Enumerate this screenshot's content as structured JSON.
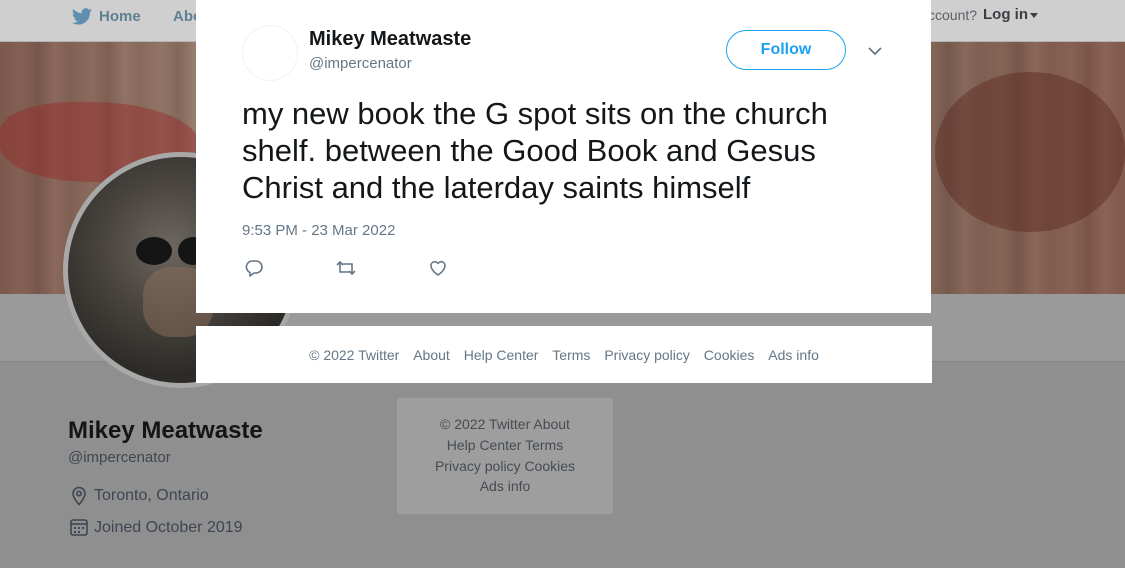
{
  "topbar": {
    "home_label": "Home",
    "about_label": "Abo",
    "account_text": "ccount?",
    "login_label": "Log in",
    "icons": [
      "twitter-bird-icon",
      "caret-down-icon"
    ]
  },
  "profile": {
    "name": "Mikey Meatwaste",
    "handle": "@impercenator",
    "location": "Toronto, Ontario",
    "joined": "Joined October 2019",
    "icons": [
      "location-pin-icon",
      "calendar-icon"
    ]
  },
  "dim_footer": {
    "line1": "© 2022 Twitter   About",
    "line2": "Help Center   Terms",
    "line3": "Privacy policy   Cookies",
    "line4": "Ads info"
  },
  "tweet": {
    "author_name": "Mikey Meatwaste",
    "author_handle": "@impercenator",
    "follow_label": "Follow",
    "text": "my new book the G spot sits on the church shelf. between the Good Book and Gesus Christ and the laterday saints himself",
    "timestamp": "9:53 PM - 23 Mar 2022",
    "icons": [
      "reply-icon",
      "retweet-icon",
      "like-icon",
      "chevron-down-icon"
    ]
  },
  "footer": {
    "copyright": "© 2022 Twitter",
    "about": "About",
    "help_center": "Help Center",
    "terms": "Terms",
    "privacy": "Privacy policy",
    "cookies": "Cookies",
    "ads_info": "Ads info"
  },
  "colors": {
    "accent": "#1da1f2",
    "secondary_text": "#657786",
    "overlay": "#8f8f8f"
  }
}
